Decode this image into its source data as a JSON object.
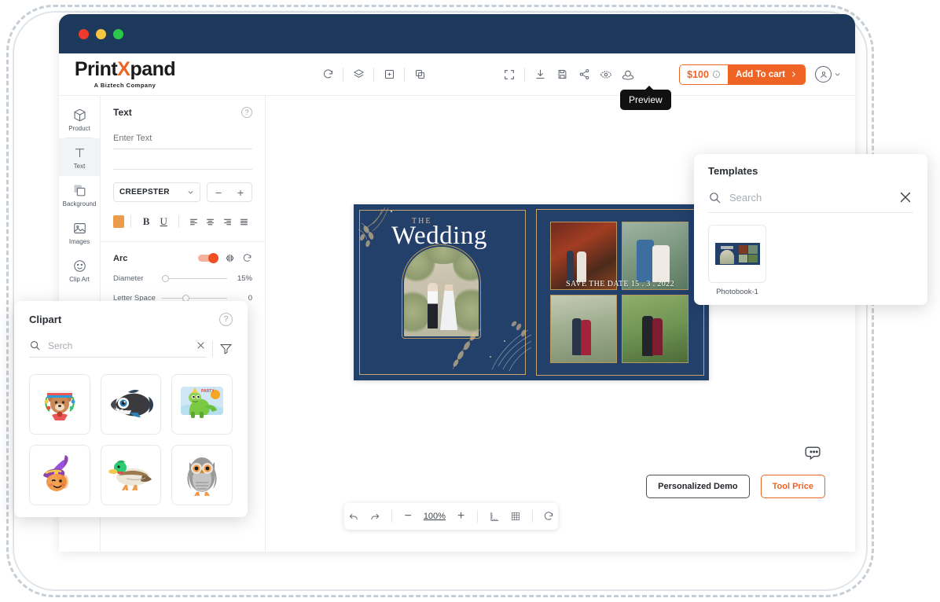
{
  "window": {
    "traffic_lights": [
      "red",
      "yellow",
      "green"
    ]
  },
  "header": {
    "logo_part1": "Print",
    "logo_x": "X",
    "logo_part2": "pand",
    "logo_tagline": "A Biztech Company",
    "tools": [
      {
        "name": "reset-icon",
        "title": "Reset"
      },
      {
        "name": "layers-icon",
        "title": "Layers"
      },
      {
        "name": "add-object-icon",
        "title": "Add Object"
      },
      {
        "name": "duplicate-icon",
        "title": "Duplicate"
      },
      {
        "name": "fullscreen-icon",
        "title": "Fullscreen"
      },
      {
        "name": "download-icon",
        "title": "Download"
      },
      {
        "name": "save-icon",
        "title": "Save"
      },
      {
        "name": "share-icon",
        "title": "Share"
      },
      {
        "name": "preview-eye-icon",
        "title": "Preview"
      },
      {
        "name": "three-d-view-icon",
        "title": "3D View"
      }
    ],
    "price": "$100",
    "cart_label": "Add To cart",
    "tooltip": "Preview"
  },
  "sidebar": {
    "items": [
      {
        "label": "Product",
        "icon": "cube-icon",
        "active": false
      },
      {
        "label": "Text",
        "icon": "text-t-icon",
        "active": true
      },
      {
        "label": "Background",
        "icon": "background-icon",
        "active": false
      },
      {
        "label": "Images",
        "icon": "image-icon",
        "active": false
      },
      {
        "label": "Clip Art",
        "icon": "smiley-icon",
        "active": false
      },
      {
        "label": "",
        "icon": "gallery-icon",
        "active": false
      }
    ]
  },
  "text_panel": {
    "title": "Text",
    "help": "?",
    "input_placeholder": "Enter Text",
    "input_value": "",
    "font_name": "CREEPSTER",
    "decrease_label": "−",
    "increase_label": "+",
    "color_swatch": "#eb9b4c",
    "bold_label": "B",
    "underline_label": "U",
    "aligns": [
      "align-left",
      "align-center",
      "align-right",
      "align-justify"
    ],
    "arc": {
      "title": "Arc",
      "toggle_on": true,
      "flip_icon": "flip-icon",
      "reset_icon": "reset-icon",
      "diameter_label": "Diameter",
      "diameter_value": "15%",
      "letter_space_label": "Letter Space",
      "letter_space_value": "0"
    }
  },
  "clipart_panel": {
    "title": "Clipart",
    "help": "?",
    "search_placeholder": "Serch",
    "search_value": "",
    "clear_icon": "close-icon",
    "filter_icon": "filter-icon",
    "items": [
      {
        "name": "bear-with-scarf-clipart"
      },
      {
        "name": "piranha-fish-clipart"
      },
      {
        "name": "green-dinosaur-clipart"
      },
      {
        "name": "pumpkin-witch-hat-clipart"
      },
      {
        "name": "mallard-duck-clipart"
      },
      {
        "name": "owl-clipart"
      }
    ]
  },
  "templates_panel": {
    "title": "Templates",
    "search_placeholder": "Search",
    "search_value": "",
    "close_icon": "close-icon",
    "items": [
      {
        "label": "Photobook-1"
      }
    ]
  },
  "canvas": {
    "design": {
      "left_page": {
        "eyebrow": "THE",
        "headline": "Wedding"
      },
      "right_page": {
        "save_the_date": "SAVE THE DATE 15 . 3 . 2022",
        "photo_count": 4
      },
      "background_color": "#23406b",
      "accent_color": "#c6a36b"
    }
  },
  "bottom_bar": {
    "undo": "undo-icon",
    "redo": "redo-icon",
    "zoom_out": "−",
    "zoom_value": "100%",
    "zoom_in": "+",
    "ruler": "ruler-icon",
    "grid": "grid-icon",
    "reset": "reset-icon"
  },
  "footer": {
    "chat_icon": "chat-bubble-icon",
    "demo_button": "Personalized Demo",
    "price_button": "Tool Price"
  },
  "colors": {
    "brand_orange": "#ef6425",
    "titlebar_navy": "#1d3a5c",
    "design_navy": "#23406b",
    "design_gold": "#c6a36b"
  }
}
